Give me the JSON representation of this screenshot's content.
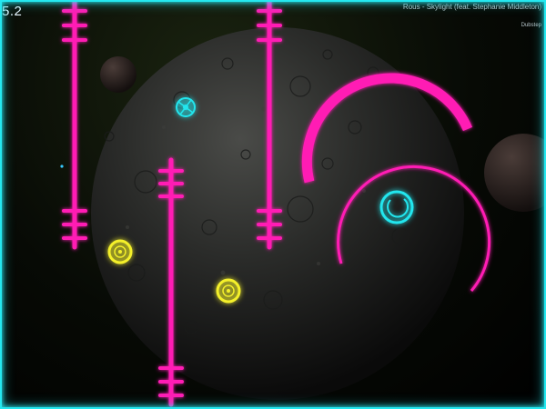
{
  "hud": {
    "score": "5.2",
    "song_title": "Rous - Skylight (feat. Stephanie Middleton)",
    "genre": "Dubstep"
  },
  "colors": {
    "frame": "#25e8f0",
    "hazard_magenta": "#ff1fb4",
    "player_cyan": "#22e6ee",
    "pickup_yellow": "#f4f02a",
    "planet": "#2a2b2a"
  },
  "icons": {
    "player": "cyan-ring-player-icon",
    "pickup": "yellow-orb-pickup-icon",
    "enemy": "cyan-satellite-drone-icon"
  }
}
